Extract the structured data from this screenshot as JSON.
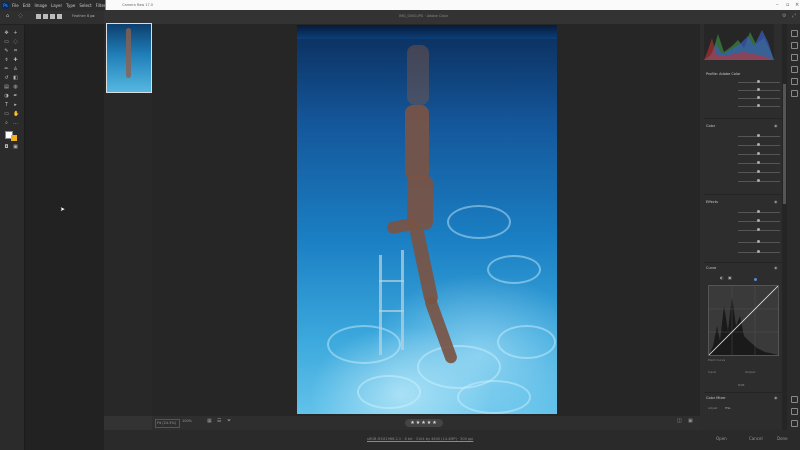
{
  "menubar": {
    "logo": "Ps",
    "items": [
      "File",
      "Edit",
      "Image",
      "Layer",
      "Type",
      "Select",
      "Filter",
      "View"
    ]
  },
  "options_bar": {
    "feather_label": "Feather:",
    "feather_value": "0 px"
  },
  "camera_raw": {
    "window_title": "Camera Raw 17.0",
    "filename": "IMG_0000.JPG · Adobe Color",
    "footer_workflow": "sRGB IEC61966-2.1 · 8 bit · 3104 by 4640 (14.4MP) · 300 ppi",
    "zoom": "Fit (24.3%)",
    "zoom_pct": "100%",
    "rating": "★★★★★",
    "buttons": {
      "open": "Open",
      "cancel": "Cancel",
      "done": "Done"
    },
    "sections": {
      "basic_profile": "Profile: Adobe Color",
      "color": "Color",
      "effects": "Effects",
      "curve": "Curve",
      "color_mixer": "Color Mixer"
    },
    "sliders_color": [
      "Temperature",
      "Tint",
      "Vibrance",
      "Saturation",
      "Texture",
      "Clarity",
      "Dehaze"
    ],
    "sliders_effects": [
      "Grain",
      "Size",
      "Roughness",
      "Vignette",
      "Midpoint"
    ],
    "curve_labels": {
      "point_curve": "Point Curve",
      "channel": "RGB",
      "input": "Input",
      "output": "Output"
    },
    "mixer_labels": {
      "adjust": "Adjust",
      "mode": "HSL"
    }
  },
  "colors": {
    "accent": "#4a90d9",
    "photo_water": "#1b7fc3"
  }
}
